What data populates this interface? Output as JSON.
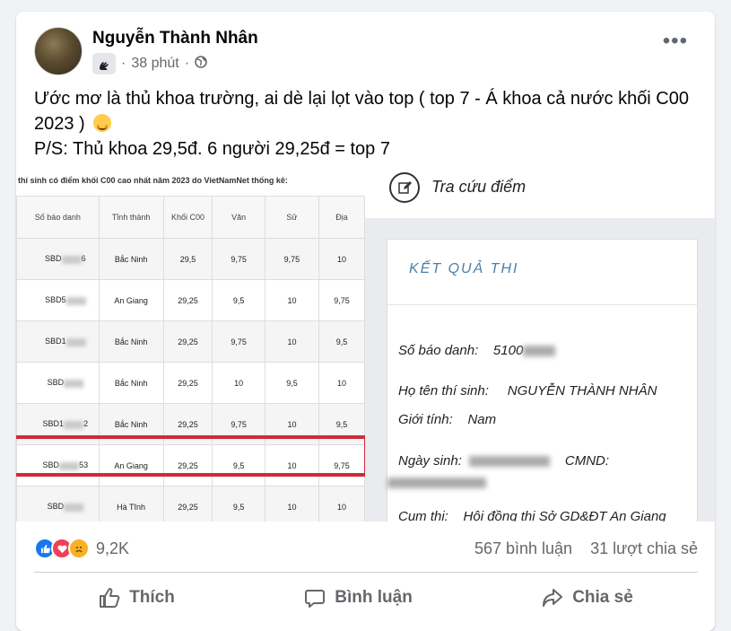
{
  "post": {
    "author": "Nguyễn Thành Nhân",
    "time": "38 phút",
    "caption_line1": "Ước mơ là thủ khoa trường, ai dè lại lọt vào top ( top 7 - Á khoa cả nước khối C00",
    "caption_line2": "2023 )",
    "caption_line3": "P/S: Thủ khoa 29,5đ. 6 người 29,25đ = top 7"
  },
  "left_image": {
    "heading": "thí sinh có điểm khối C00 cao nhất năm 2023 do VietNamNet thống kê:",
    "columns": [
      "Số báo danh",
      "Tỉnh thành",
      "Khối C00",
      "Văn",
      "Sử",
      "Địa"
    ],
    "rows": [
      {
        "sbd_a": "SBD",
        "sbd_b": "6",
        "province": "Bắc Ninh",
        "total": "29,5",
        "van": "9,75",
        "su": "9,75",
        "dia": "10"
      },
      {
        "sbd_a": "SBD5",
        "sbd_b": "",
        "province": "An Giang",
        "total": "29,25",
        "van": "9,5",
        "su": "10",
        "dia": "9,75"
      },
      {
        "sbd_a": "SBD1",
        "sbd_b": "",
        "province": "Bắc Ninh",
        "total": "29,25",
        "van": "9,75",
        "su": "10",
        "dia": "9,5"
      },
      {
        "sbd_a": "SBD",
        "sbd_b": "",
        "province": "Bắc Ninh",
        "total": "29,25",
        "van": "10",
        "su": "9,5",
        "dia": "10"
      },
      {
        "sbd_a": "SBD1",
        "sbd_b": "2",
        "province": "Bắc Ninh",
        "total": "29,25",
        "van": "9,75",
        "su": "10",
        "dia": "9,5"
      },
      {
        "sbd_a": "SBD",
        "sbd_b": "53",
        "province": "An Giang",
        "total": "29,25",
        "van": "9,5",
        "su": "10",
        "dia": "9,75"
      },
      {
        "sbd_a": "SBD",
        "sbd_b": "",
        "province": "Hà Tĩnh",
        "total": "29,25",
        "van": "9,5",
        "su": "10",
        "dia": "10"
      }
    ]
  },
  "right_image": {
    "lookup_label": "Tra cứu điểm",
    "result_title": "KẾT QUẢ THI",
    "sbd_label": "Số báo danh:",
    "sbd_value": "5100",
    "name_label": "Họ tên thí sinh:",
    "name_value": "NGUYỄN THÀNH NHÂN",
    "gender_label": "Giới tính:",
    "gender_value": "Nam",
    "dob_label": "Ngày sinh:",
    "id_label": "CMND:",
    "cluster_label": "Cụm thi:",
    "cluster_value": "Hội đồng thi Sở GD&ĐT An Giang"
  },
  "stats": {
    "reactions_count": "9,2K",
    "comments": "567 bình luận",
    "shares": "31 lượt chia sẻ"
  },
  "actions": {
    "like": "Thích",
    "comment": "Bình luận",
    "share": "Chia sẻ"
  },
  "icons": {
    "more": "more-options-icon",
    "group": "group-badge-icon",
    "privacy": "globe-icon",
    "like": "thumbs-up-icon",
    "comment": "comment-bubble-icon",
    "share": "share-arrow-icon"
  }
}
